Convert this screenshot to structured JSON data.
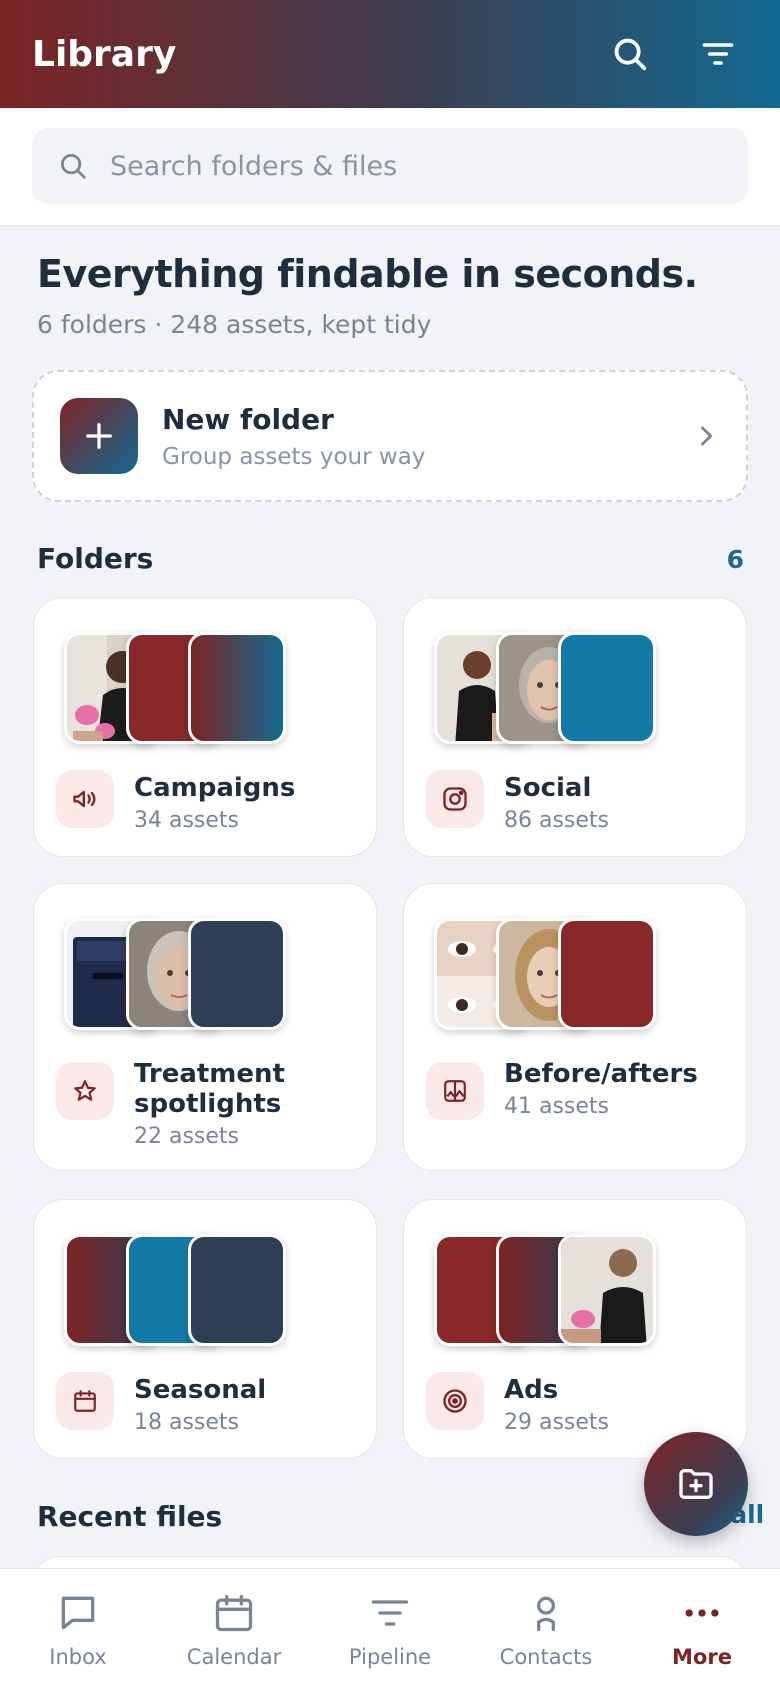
{
  "appbar": {
    "title": "Library"
  },
  "search": {
    "placeholder": "Search folders & files"
  },
  "hero": {
    "title": "Everything findable in seconds.",
    "subtitle": "6 folders · 248 assets, kept tidy"
  },
  "new_folder": {
    "title": "New folder",
    "subtitle": "Group assets your way"
  },
  "folders_section": {
    "title": "Folders",
    "count": "6"
  },
  "folders": [
    {
      "name": "Campaigns",
      "count": "34 assets",
      "icon": "megaphone-icon"
    },
    {
      "name": "Social",
      "count": "86 assets",
      "icon": "instagram-icon"
    },
    {
      "name": "Treatment spotlights",
      "count": "22 assets",
      "icon": "star-icon"
    },
    {
      "name": "Before/afters",
      "count": "41 assets",
      "icon": "image-compare-icon"
    },
    {
      "name": "Seasonal",
      "count": "18 assets",
      "icon": "calendar-icon"
    },
    {
      "name": "Ads",
      "count": "29 assets",
      "icon": "target-icon"
    }
  ],
  "recent_section": {
    "title": "Recent files",
    "action": "View all"
  },
  "nav": [
    {
      "label": "Inbox",
      "icon": "chat-icon"
    },
    {
      "label": "Calendar",
      "icon": "calendar-icon"
    },
    {
      "label": "Pipeline",
      "icon": "filter-icon"
    },
    {
      "label": "Contacts",
      "icon": "person-icon"
    },
    {
      "label": "More",
      "icon": "more-dots-icon",
      "active": true
    }
  ],
  "colors": {
    "brand_red": "#7c2424",
    "brand_blue": "#126a92",
    "navy": "#2e3e55",
    "accent_link": "#1a6a90"
  }
}
